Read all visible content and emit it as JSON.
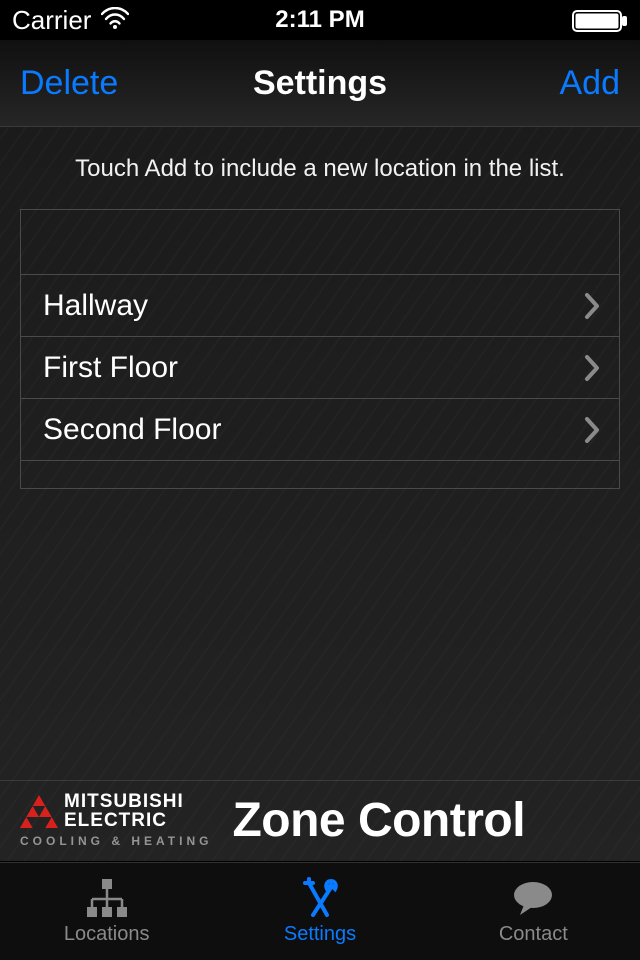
{
  "status_bar": {
    "carrier": "Carrier",
    "time": "2:11 PM"
  },
  "nav": {
    "left_label": "Delete",
    "title": "Settings",
    "right_label": "Add"
  },
  "instruction": "Touch Add to include a new location in the list.",
  "locations": [
    {
      "label": "Hallway"
    },
    {
      "label": "First Floor"
    },
    {
      "label": "Second Floor"
    }
  ],
  "brand": {
    "logo_line1": "MITSUBISHI",
    "logo_line2": "ELECTRIC",
    "subline": "COOLING & HEATING",
    "app_name": "Zone Control"
  },
  "tabs": [
    {
      "id": "locations",
      "label": "Locations",
      "icon": "tree-icon",
      "active": false
    },
    {
      "id": "settings",
      "label": "Settings",
      "icon": "tools-icon",
      "active": true
    },
    {
      "id": "contact",
      "label": "Contact",
      "icon": "chat-icon",
      "active": false
    }
  ],
  "colors": {
    "accent": "#0a7aff",
    "brand_red": "#d8211d"
  }
}
